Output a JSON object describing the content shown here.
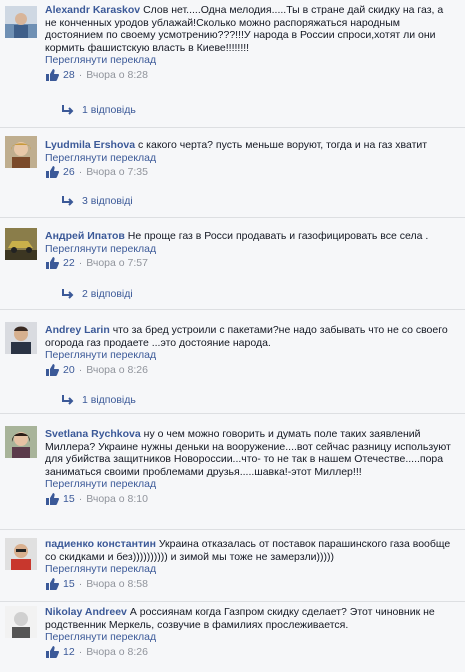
{
  "colors": {
    "link": "#3b5998",
    "meta": "#90949c",
    "background": "#f6f7f9"
  },
  "comments": [
    {
      "author": "Alexandr Karaskov",
      "text": "Слов нет.....Одна мелодия.....Ты в стране дай скидку на газ, а не конченных уродов ублажай!Сколько можно распоряжаться народным достоянием по своему усмотрению???!!!У народа в России спроси,хотят ли они кормить фашистскую власть в Киеве!!!!!!!!",
      "translate": "Переглянути переклад",
      "likes": "28",
      "time": "Вчора о 8:28",
      "replies": "1 відповідь",
      "avatar_icon": "person-icon"
    },
    {
      "author": "Lyudmila Ershova",
      "text": "с какого черта? пусть меньше воруют, тогда и на газ хватит",
      "translate": "Переглянути переклад",
      "likes": "26",
      "time": "Вчора о 7:35",
      "replies": "3 відповіді",
      "avatar_icon": "person-icon"
    },
    {
      "author": "Андрей Ипатов",
      "text": "Не проще газ в Росси продавать и газофицировать все села .",
      "translate": "Переглянути переклад",
      "likes": "22",
      "time": "Вчора о 7:57",
      "replies": "2 відповіді",
      "avatar_icon": "car-icon"
    },
    {
      "author": "Andrey Larin",
      "text": "что за бред устроили с пакетами?не надо забывать что не со своего огорода газ продаете ...это достояние народа.",
      "translate": "Переглянути переклад",
      "likes": "20",
      "time": "Вчора о 8:26",
      "replies": "1 відповідь",
      "avatar_icon": "person-icon"
    },
    {
      "author": "Svetlana Rychkova",
      "text": "ну о чем можно говорить и думать поле таких заявлений Миллера? Украине нужны деньки на вооружение....вот сейчас разницу используют для убийства защитников Новороссии...что- то не так в нашем Отечестве.....пора заниматься своими проблемами друзья.....шавка!-этот Миллер!!!",
      "translate": "Переглянути переклад",
      "likes": "15",
      "time": "Вчора о 8:10",
      "avatar_icon": "person-icon"
    },
    {
      "author": "падиенко константин",
      "text": "Украина отказалась от поставок парашинского газа вообще со скидками и без)))))))))) и зимой мы тоже не замерзли)))))",
      "translate": "Переглянути переклад",
      "likes": "15",
      "time": "Вчора о 8:58",
      "avatar_icon": "person-icon"
    },
    {
      "author": "Nikolay Andreev",
      "text": "А россиянам когда Газпром скидку сделает? Этот чиновник не родственник Меркель, созвучие в фамилиях прослеживается.",
      "translate": "Переглянути переклад",
      "likes": "12",
      "time": "Вчора о 8:26",
      "avatar_icon": "person-icon"
    }
  ]
}
